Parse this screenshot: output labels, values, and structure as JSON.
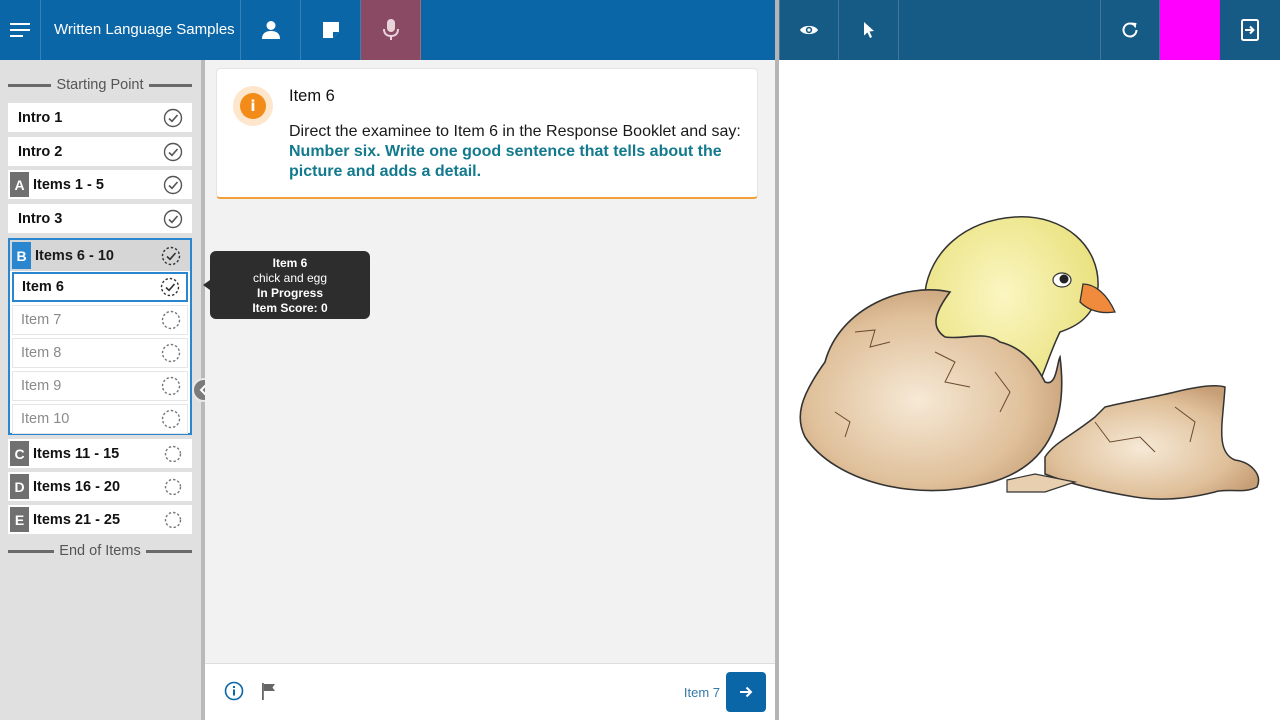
{
  "header": {
    "title": "Written Language Samples",
    "tools_left": [
      "menu-icon",
      "person-icon",
      "note-icon",
      "microphone-icon"
    ],
    "tools_right": [
      "eye-icon",
      "cursor-icon",
      "refresh-icon",
      "exit-icon"
    ],
    "colors": {
      "bar_left": "#0b66a8",
      "bar_right": "#165a86",
      "mic_active": "#8b4a63",
      "magenta": "#ff00ff"
    }
  },
  "sidebar": {
    "start_label": "Starting Point",
    "end_label": "End of Items",
    "items": [
      {
        "letter": "",
        "label": "Intro 1",
        "status": "complete"
      },
      {
        "letter": "",
        "label": "Intro 2",
        "status": "complete"
      },
      {
        "letter": "A",
        "label": "Items 1 - 5",
        "status": "complete"
      },
      {
        "letter": "",
        "label": "Intro 3",
        "status": "complete"
      }
    ],
    "group_b": {
      "letter": "B",
      "label": "Items 6 - 10",
      "status": "in-progress",
      "subitems": [
        {
          "label": "Item 6",
          "status": "in-progress",
          "active": true
        },
        {
          "label": "Item 7",
          "status": "not-started"
        },
        {
          "label": "Item 8",
          "status": "not-started"
        },
        {
          "label": "Item 9",
          "status": "not-started"
        },
        {
          "label": "Item 10",
          "status": "not-started"
        }
      ]
    },
    "after": [
      {
        "letter": "C",
        "label": "Items 11 - 15",
        "status": "not-started"
      },
      {
        "letter": "D",
        "label": "Items 16 - 20",
        "status": "not-started"
      },
      {
        "letter": "E",
        "label": "Items 21 - 25",
        "status": "not-started"
      }
    ]
  },
  "card": {
    "title": "Item 6",
    "instruction": "Direct the examinee to Item 6 in the Response Booklet and say: ",
    "say": "Number six. Write one good sentence that tells about the picture and adds a detail."
  },
  "tooltip": {
    "title": "Item 6",
    "desc": "chick and egg",
    "status": "In Progress",
    "score": "Item Score: 0"
  },
  "footer": {
    "next_label": "Item 7"
  },
  "stimulus": {
    "icon": "chick-hatching-icon"
  }
}
